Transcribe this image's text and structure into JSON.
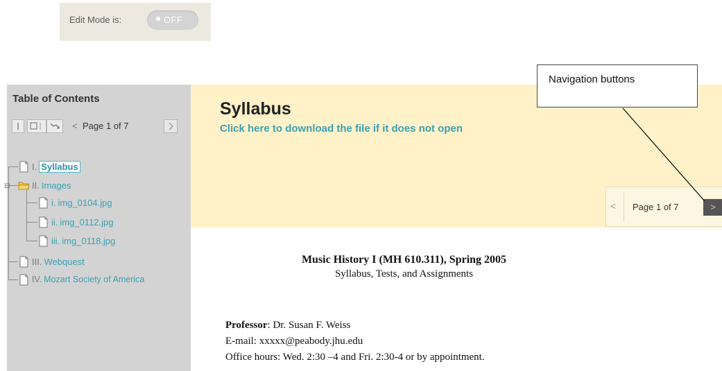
{
  "edit_mode": {
    "label": "Edit Mode is:",
    "state": "OFF"
  },
  "toc": {
    "title": "Table of Contents",
    "page_label": "Page 1 of 7",
    "items": [
      {
        "num": "I.",
        "label": "Syllabus",
        "selected": true,
        "icon": "page-icon"
      },
      {
        "num": "II.",
        "label": "Images",
        "icon": "folder-icon"
      },
      {
        "num": "i.",
        "label": "img_0104.jpg",
        "icon": "page-icon"
      },
      {
        "num": "ii.",
        "label": "img_0112.jpg",
        "icon": "page-icon"
      },
      {
        "num": "iii.",
        "label": "img_0118.jpg",
        "icon": "page-icon"
      },
      {
        "num": "III.",
        "label": "Webquest",
        "icon": "page-icon"
      },
      {
        "num": "IV.",
        "label": "Mozart Society of America",
        "icon": "page-icon"
      }
    ]
  },
  "content": {
    "title": "Syllabus",
    "download_link": "Click here to download the file if it does not open",
    "pager_label": "Page 1 of 7",
    "doc": {
      "heading": "Music History I (MH 610.311), Spring 2005",
      "subheading": "Syllabus, Tests, and Assignments",
      "professor_label": "Professor",
      "professor_name": ": Dr. Susan F. Weiss",
      "email": "E-mail: xxxxx@peabody.jhu.edu",
      "office_hours": "Office hours: Wed. 2:30 –4 and Fri. 2:30-4 or by appointment."
    }
  },
  "callout": {
    "text": "Navigation buttons"
  },
  "colors": {
    "link": "#3aa0b4",
    "header_bg": "#fff2c8",
    "sidebar_bg": "#d3d3d3"
  }
}
